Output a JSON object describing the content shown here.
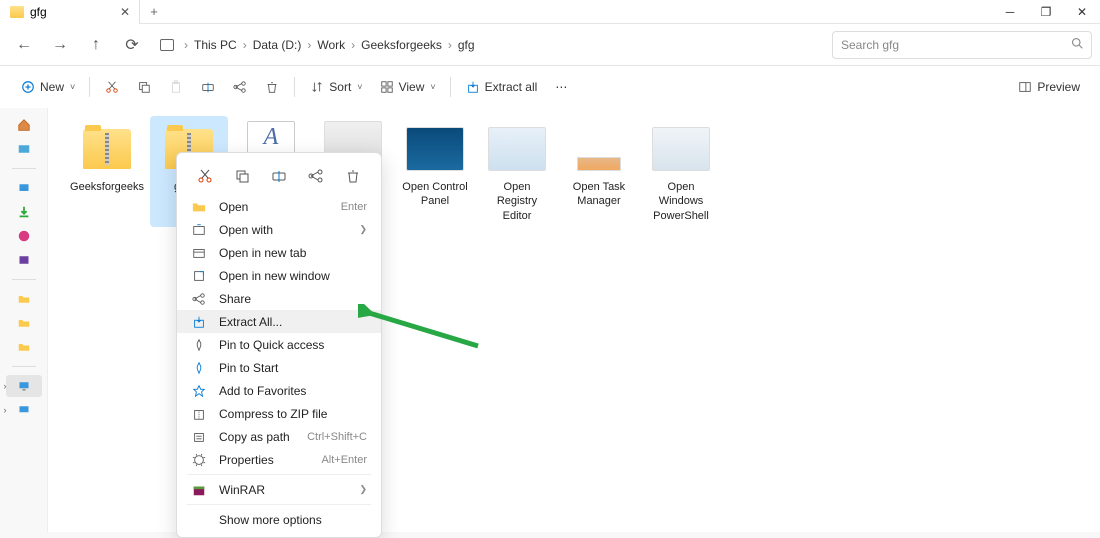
{
  "tab": {
    "title": "gfg"
  },
  "breadcrumb": [
    "This PC",
    "Data (D:)",
    "Work",
    "Geeksforgeeks",
    "gfg"
  ],
  "search": {
    "placeholder": "Search gfg"
  },
  "toolbar": {
    "new": "New",
    "sort": "Sort",
    "view": "View",
    "extract_all": "Extract all",
    "preview": "Preview"
  },
  "files": [
    {
      "name": "Geeksforgeeks",
      "type": "folder-zip"
    },
    {
      "name": "gpedit",
      "type": "folder-zip",
      "selected": true
    },
    {
      "name": "",
      "type": "doc"
    },
    {
      "name": "",
      "type": "img-wide",
      "bg": "linear-gradient(#f0f0f0,#d8d8d8)"
    },
    {
      "name": "Open Control Panel",
      "type": "img",
      "bg": "linear-gradient(#0a4a7a,#1a6aa0)"
    },
    {
      "name": "Open Registry Editor",
      "type": "img",
      "bg": "linear-gradient(#e8f0f8,#cde0ef)"
    },
    {
      "name": "Open Task Manager",
      "type": "img-small",
      "bg": "linear-gradient(#e8b888,#f0a860)"
    },
    {
      "name": "Open Windows PowerShell",
      "type": "img",
      "bg": "linear-gradient(#f0f4f8,#d8e4ec)"
    }
  ],
  "context_menu": {
    "items": [
      {
        "label": "Open",
        "shortcut": "Enter",
        "icon": "folder"
      },
      {
        "label": "Open with",
        "sub": true,
        "icon": "openwith"
      },
      {
        "label": "Open in new tab",
        "icon": "newtab"
      },
      {
        "label": "Open in new window",
        "icon": "newwindow"
      },
      {
        "label": "Share",
        "icon": "share"
      },
      {
        "label": "Extract All...",
        "icon": "extract",
        "hover": true
      },
      {
        "label": "Pin to Quick access",
        "icon": "pin"
      },
      {
        "label": "Pin to Start",
        "icon": "pinstart"
      },
      {
        "label": "Add to Favorites",
        "icon": "star"
      },
      {
        "label": "Compress to ZIP file",
        "icon": "zip"
      },
      {
        "label": "Copy as path",
        "shortcut": "Ctrl+Shift+C",
        "icon": "copypath"
      },
      {
        "label": "Properties",
        "shortcut": "Alt+Enter",
        "icon": "props"
      },
      {
        "sep": true
      },
      {
        "label": "WinRAR",
        "sub": true,
        "icon": "winrar"
      },
      {
        "sep": true
      },
      {
        "label": "Show more options",
        "icon": "more"
      }
    ]
  }
}
